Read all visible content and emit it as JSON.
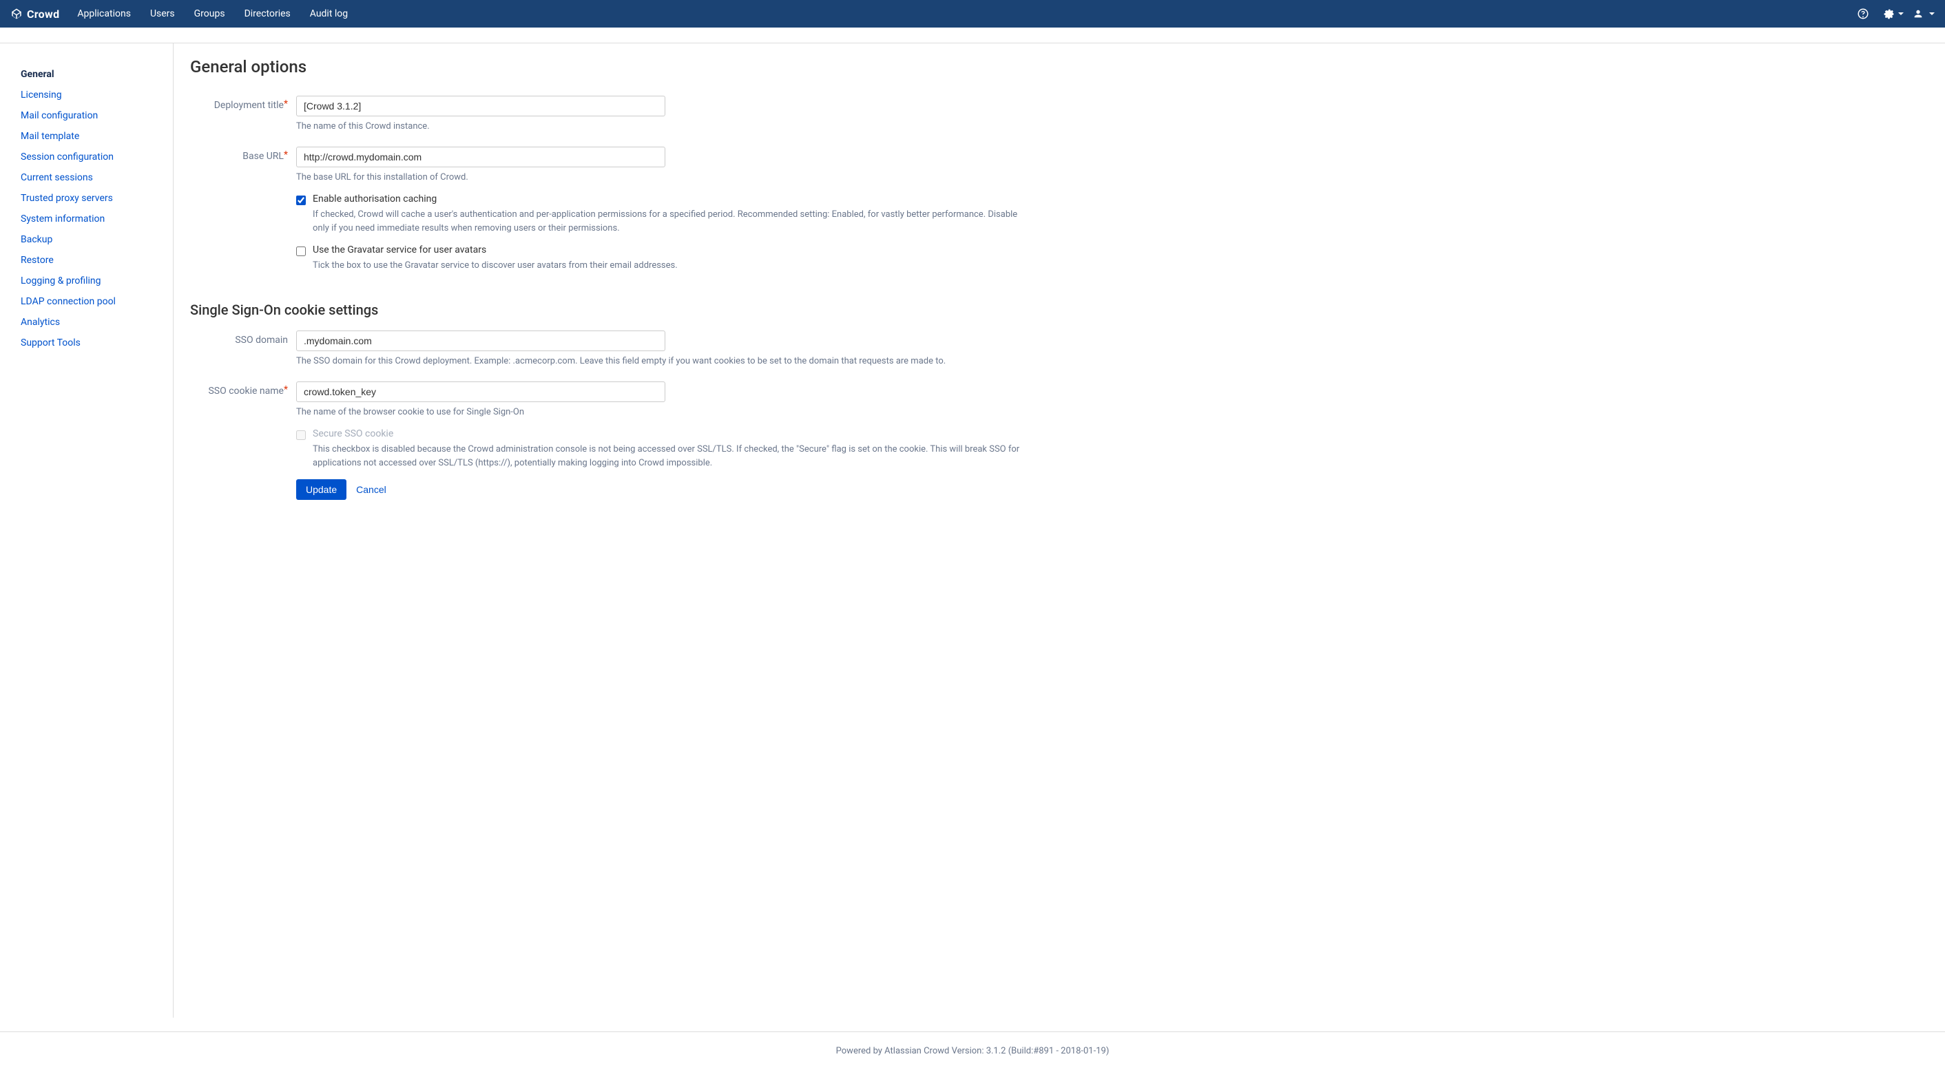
{
  "brand": "Crowd",
  "nav": [
    "Applications",
    "Users",
    "Groups",
    "Directories",
    "Audit log"
  ],
  "sidebar": {
    "items": [
      {
        "label": "General",
        "active": true
      },
      {
        "label": "Licensing"
      },
      {
        "label": "Mail configuration"
      },
      {
        "label": "Mail template"
      },
      {
        "label": "Session configuration"
      },
      {
        "label": "Current sessions"
      },
      {
        "label": "Trusted proxy servers"
      },
      {
        "label": "System information"
      },
      {
        "label": "Backup"
      },
      {
        "label": "Restore"
      },
      {
        "label": "Logging & profiling"
      },
      {
        "label": "LDAP connection pool"
      },
      {
        "label": "Analytics"
      },
      {
        "label": "Support Tools"
      }
    ]
  },
  "page": {
    "title": "General options",
    "section2_title": "Single Sign-On cookie settings"
  },
  "form": {
    "deployment_title": {
      "label": "Deployment title",
      "value": "[Crowd 3.1.2]",
      "help": "The name of this Crowd instance."
    },
    "base_url": {
      "label": "Base URL",
      "value": "http://crowd.mydomain.com",
      "help": "The base URL for this installation of Crowd."
    },
    "enable_cache": {
      "label": "Enable authorisation caching",
      "checked": true,
      "help": "If checked, Crowd will cache a user's authentication and per-application permissions for a specified period. Recommended setting: Enabled, for vastly better performance. Disable only if you need immediate results when removing users or their permissions."
    },
    "gravatar": {
      "label": "Use the Gravatar service for user avatars",
      "checked": false,
      "help": "Tick the box to use the Gravatar service to discover user avatars from their email addresses."
    },
    "sso_domain": {
      "label": "SSO domain",
      "value": ".mydomain.com",
      "help": "The SSO domain for this Crowd deployment. Example: .acmecorp.com. Leave this field empty if you want cookies to be set to the domain that requests are made to."
    },
    "sso_cookie": {
      "label": "SSO cookie name",
      "value": "crowd.token_key",
      "help": "The name of the browser cookie to use for Single Sign-On"
    },
    "secure_sso": {
      "label": "Secure SSO cookie",
      "disabled": true,
      "help": "This checkbox is disabled because the Crowd administration console is not being accessed over SSL/TLS. If checked, the \"Secure\" flag is set on the cookie. This will break SSO for applications not accessed over SSL/TLS (https://), potentially making logging into Crowd impossible."
    }
  },
  "actions": {
    "primary": "Update",
    "cancel": "Cancel"
  },
  "footer": "Powered by Atlassian Crowd Version: 3.1.2 (Build:#891 - 2018-01-19)"
}
